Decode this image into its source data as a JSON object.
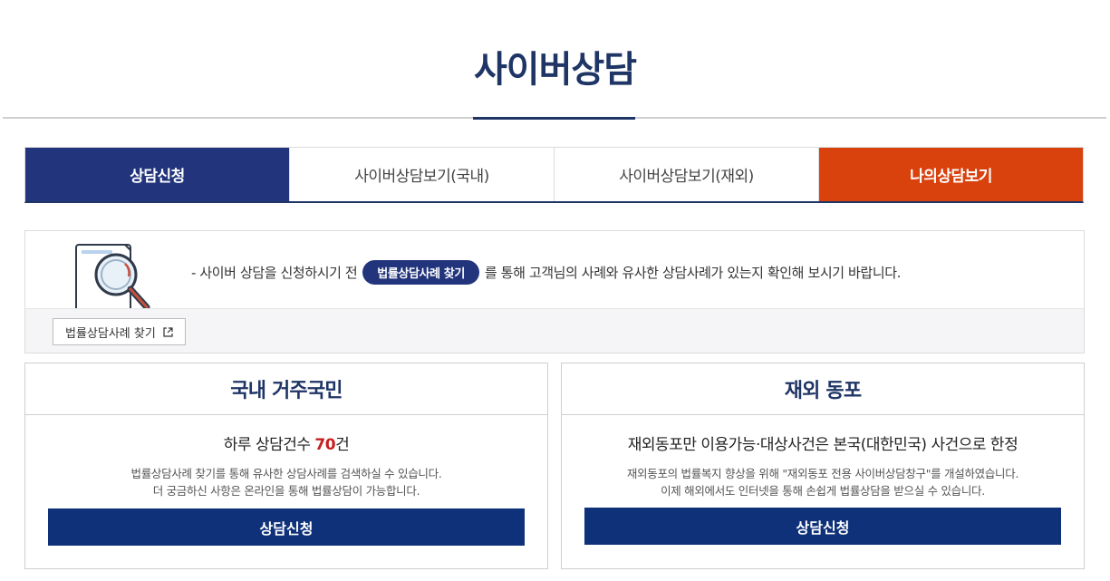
{
  "page": {
    "title": "사이버상담"
  },
  "tabs": [
    {
      "label": "상담신청"
    },
    {
      "label": "사이버상담보기(국내)"
    },
    {
      "label": "사이버상담보기(재외)"
    },
    {
      "label": "나의상담보기"
    }
  ],
  "notice": {
    "prefix": "- 사이버 상담을 신청하시기 전",
    "pill_label": "법률상담사례 찾기",
    "suffix": "를 통해 고객님의 사례와 유사한 상담사례가 있는지 확인해 보시기 바랍니다.",
    "find_button_label": "법률상담사례 찾기",
    "icon": "external-link-icon"
  },
  "domestic": {
    "title": "국내 거주국민",
    "sub_prefix": "하루 상담건수 ",
    "count": "70",
    "sub_suffix": "건",
    "desc_line1": "법률상담사례 찾기를 통해 유사한 상담사례를 검색하실 수 있습니다.",
    "desc_line2": "더 궁금하신 사항은 온라인을 통해 법률상담이 가능합니다.",
    "button_label": "상담신청"
  },
  "overseas": {
    "title": "재외 동포",
    "sub": "재외동포만 이용가능·대상사건은 본국(대한민국) 사건으로 한정",
    "desc_line1": "재외동포의 법률복지 향상을 위해 \"재외동포 전용 사이버상담창구\"를 개설하였습니다.",
    "desc_line2": "이제 해외에서도 인터넷을 통해 손쉽게 법률상담을 받으실 수 있습니다.",
    "button_label": "상담신청"
  },
  "colors": {
    "navy": "#22357c",
    "button_navy": "#0e3179",
    "orange": "#d9410d",
    "count_red": "#c81d1d"
  }
}
